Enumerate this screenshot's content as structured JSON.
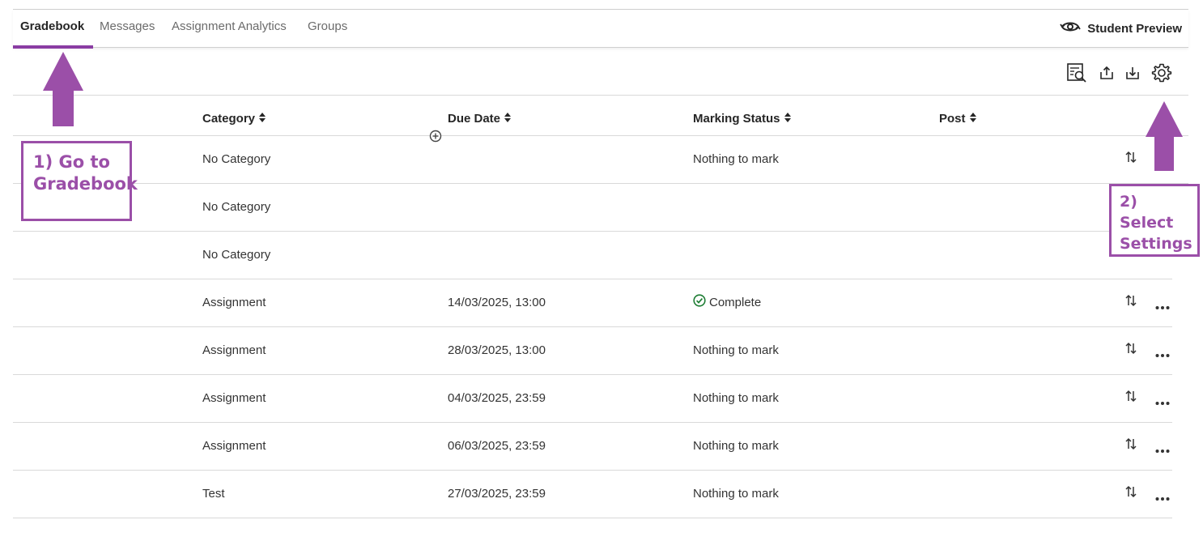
{
  "tabs": [
    {
      "label": "Gradebook"
    },
    {
      "label": "Messages"
    },
    {
      "label": "Assignment Analytics"
    },
    {
      "label": "Groups"
    }
  ],
  "header": {
    "student_preview_label": "Student Preview"
  },
  "toolbar": {
    "icons": [
      "search-document-icon",
      "upload-icon",
      "download-icon",
      "gear-icon"
    ]
  },
  "columns": {
    "category": "Category",
    "due_date": "Due Date",
    "marking_status": "Marking Status",
    "post": "Post"
  },
  "rows": [
    {
      "category": "No Category",
      "due_date": "",
      "marking_status": "Nothing to mark"
    },
    {
      "category": "No Category",
      "due_date": "",
      "marking_status": ""
    },
    {
      "category": "No Category",
      "due_date": "",
      "marking_status": ""
    },
    {
      "category": "Assignment",
      "due_date": "14/03/2025, 13:00",
      "marking_status": "Complete"
    },
    {
      "category": "Assignment",
      "due_date": "28/03/2025, 13:00",
      "marking_status": "Nothing to mark"
    },
    {
      "category": "Assignment",
      "due_date": "04/03/2025, 23:59",
      "marking_status": "Nothing to mark"
    },
    {
      "category": "Assignment",
      "due_date": "06/03/2025, 23:59",
      "marking_status": "Nothing to mark"
    },
    {
      "category": "Test",
      "due_date": "27/03/2025, 23:59",
      "marking_status": "Nothing to mark"
    }
  ],
  "annotations": {
    "step1": "1) Go to Gradebook",
    "step2": "2) Select Settings"
  },
  "colors": {
    "accent": "#8a3da3",
    "annotation": "#9b4fa8",
    "complete": "#1e7d34"
  }
}
